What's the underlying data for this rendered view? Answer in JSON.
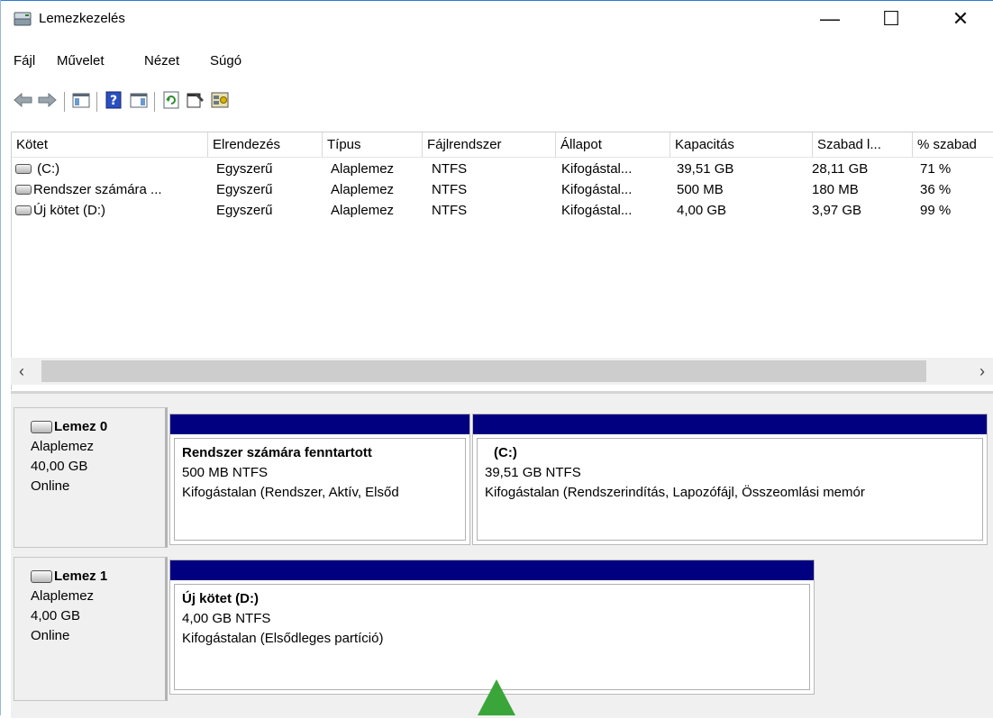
{
  "window": {
    "title": "Lemezkezelés",
    "min": "—",
    "max": "☐",
    "close": "✕"
  },
  "menu": [
    "Fájl",
    "Művelet",
    "Nézet",
    "Súgó"
  ],
  "toolbar": [
    "back-arrow-icon",
    "forward-arrow-icon",
    "console-tree-icon",
    "help-icon",
    "action-pane-icon",
    "refresh-icon",
    "properties-icon",
    "rescan-disks-icon"
  ],
  "volumes": {
    "columns": [
      "Kötet",
      "Elrendezés",
      "Típus",
      "Fájlrendszer",
      "Állapot",
      "Kapacitás",
      "Szabad l...",
      "% szabad"
    ],
    "rows": [
      [
        "(C:)",
        "Egyszerű",
        "Alaplemez",
        "NTFS",
        "Kifogástal...",
        "39,51 GB",
        "28,11 GB",
        "71 %"
      ],
      [
        "Rendszer számára ...",
        "Egyszerű",
        "Alaplemez",
        "NTFS",
        "Kifogástal...",
        "500 MB",
        "180 MB",
        "36 %"
      ],
      [
        "Új kötet (D:)",
        "Egyszerű",
        "Alaplemez",
        "NTFS",
        "Kifogástal...",
        "4,00 GB",
        "3,97 GB",
        "99 %"
      ]
    ]
  },
  "scroll": {
    "left": "‹",
    "right": "›"
  },
  "disks": [
    {
      "name": "Lemez 0",
      "type": "Alaplemez",
      "size": "40,00 GB",
      "status": "Online",
      "partitions": [
        {
          "title": "Rendszer számára fenntartott",
          "fs": "500 MB NTFS",
          "status": "Kifogástalan (Rendszer, Aktív, Elsőd"
        },
        {
          "title": "(C:)",
          "fs": "39,51 GB NTFS",
          "status": "Kifogástalan (Rendszerindítás, Lapozófájl, Összeomlási memór"
        }
      ]
    },
    {
      "name": "Lemez 1",
      "type": "Alaplemez",
      "size": "4,00 GB",
      "status": "Online",
      "partitions": [
        {
          "title": "Új kötet  (D:)",
          "fs": "4,00 GB NTFS",
          "status": "Kifogástalan (Elsődleges partíció)"
        }
      ]
    }
  ],
  "colors": {
    "partition_bar": "#000080",
    "arrow": "#3aa63a"
  }
}
